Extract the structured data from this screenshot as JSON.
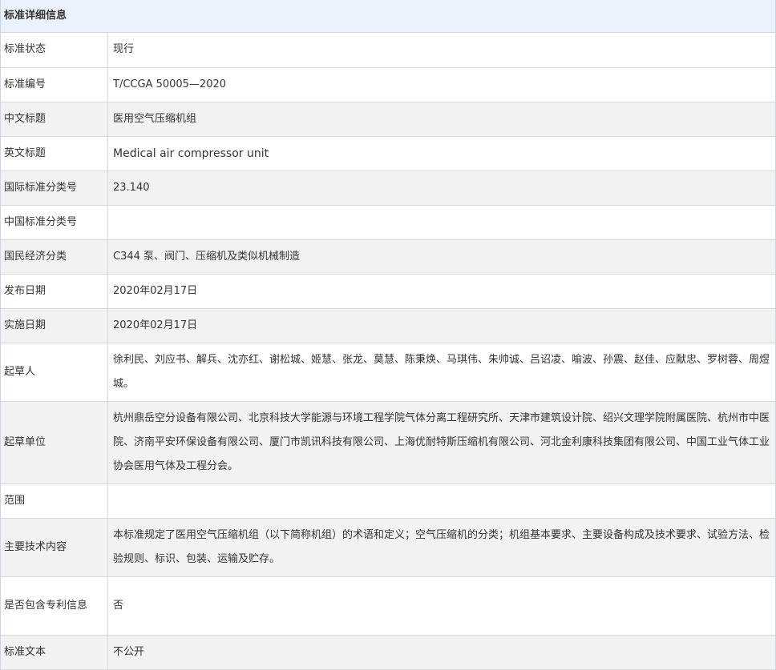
{
  "panel": {
    "title": "标准详细信息"
  },
  "rows": [
    {
      "label": "标准状态",
      "value": "现行"
    },
    {
      "label": "标准编号",
      "value": "T/CCGA 50005—2020"
    },
    {
      "label": "中文标题",
      "value": "医用空气压缩机组"
    },
    {
      "label": "英文标题",
      "value": "Medical air compressor unit"
    },
    {
      "label": "国际标准分类号",
      "value": "23.140"
    },
    {
      "label": "中国标准分类号",
      "value": ""
    },
    {
      "label": "国民经济分类",
      "value": "C344 泵、阀门、压缩机及类似机械制造"
    },
    {
      "label": "发布日期",
      "value": "2020年02月17日"
    },
    {
      "label": "实施日期",
      "value": "2020年02月17日"
    },
    {
      "label": "起草人",
      "value": "徐利民、刘应书、解兵、沈亦红、谢松城、姬慧、张龙、莫慧、陈秉焕、马琪伟、朱帅诚、吕诏凌、喻波、孙震、赵佳、应献忠、罗树蓉、周煜城。"
    },
    {
      "label": "起草单位",
      "value": "杭州鼎岳空分设备有限公司、北京科技大学能源与环境工程学院气体分离工程研究所、天津市建筑设计院、绍兴文理学院附属医院、杭州市中医院、济南平安环保设备有限公司、厦门市凯讯科技有限公司、上海优耐特斯压缩机有限公司、河北金利康科技集团有限公司、中国工业气体工业协会医用气体及工程分会。"
    },
    {
      "label": "范围",
      "value": ""
    },
    {
      "label": "主要技术内容",
      "value": "本标准规定了医用空气压缩机组（以下简称机组）的术语和定义；空气压缩机的分类；机组基本要求、主要设备构成及技术要求、试验方法、检验规则、标识、包装、运输及贮存。"
    },
    {
      "label": "是否包含专利信息",
      "value": "否"
    },
    {
      "label": "标准文本",
      "value": "不公开"
    }
  ]
}
